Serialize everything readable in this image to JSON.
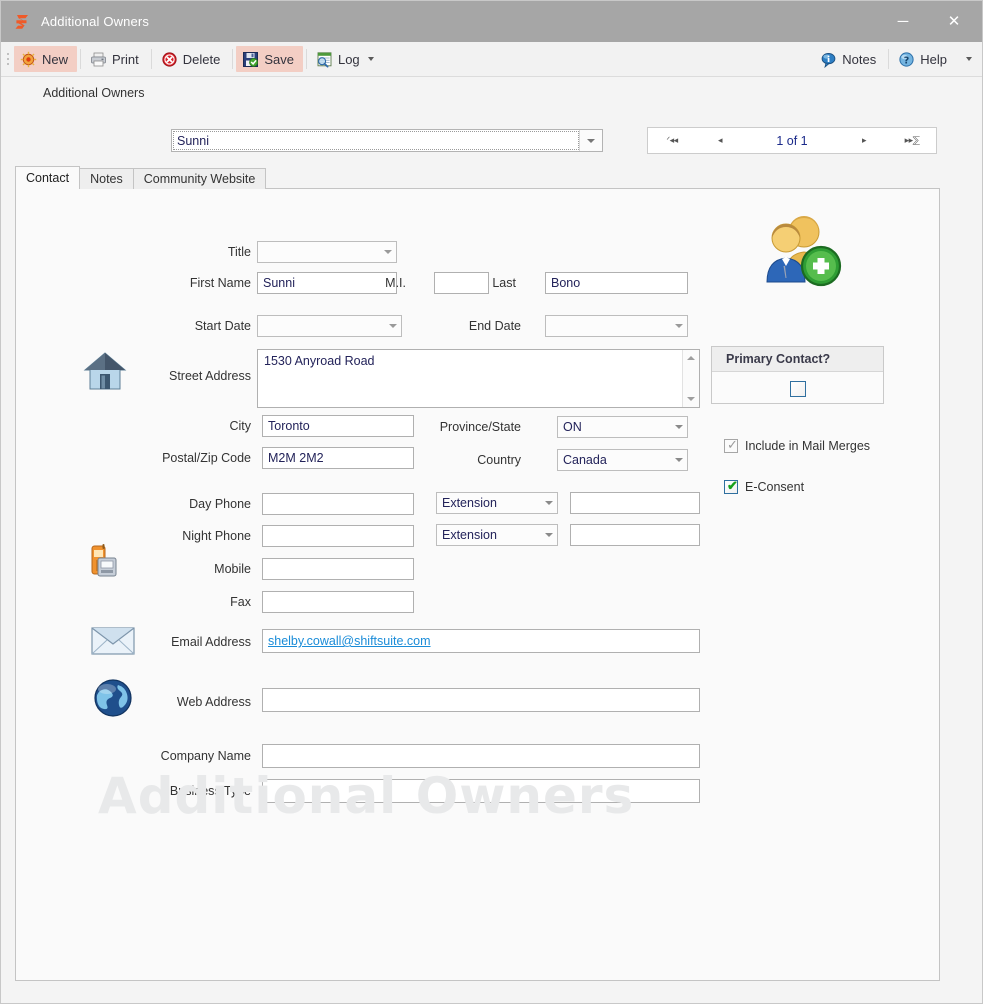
{
  "window": {
    "title": "Additional Owners",
    "app_icon": "shiftsuite-logo-icon",
    "minimize_label": "─",
    "close_label": "✕"
  },
  "toolbar": {
    "buttons": [
      {
        "label": "New",
        "icon": "new-record-icon",
        "highlighted": true
      },
      {
        "label": "Print",
        "icon": "printer-icon",
        "highlighted": false
      },
      {
        "label": "Delete",
        "icon": "delete-stop-icon",
        "highlighted": false
      },
      {
        "label": "Save",
        "icon": "save-disk-icon",
        "highlighted": true
      },
      {
        "label": "Log",
        "icon": "log-search-icon",
        "highlighted": false,
        "has_caret": true
      }
    ],
    "right_buttons": [
      {
        "label": "Notes",
        "icon": "notes-balloon-icon"
      },
      {
        "label": "Help",
        "icon": "help-question-icon"
      }
    ],
    "overflow_icon": "chevron-down-icon"
  },
  "record_selector": {
    "label": "Additional Owners",
    "value": "Sunni",
    "placeholder": ""
  },
  "navigator": {
    "first_label": "ᐟ◂◂",
    "prev_label": "◂",
    "position": "1 of 1",
    "next_label": "▸",
    "last_label": "▸▸⅀"
  },
  "tabs": [
    {
      "label": "Contact",
      "active": true
    },
    {
      "label": "Notes",
      "active": false
    },
    {
      "label": "Community Website",
      "active": false
    }
  ],
  "form": {
    "title": {
      "label": "Title",
      "value": ""
    },
    "first_name": {
      "label": "First Name",
      "value": "Sunni"
    },
    "mi": {
      "label": "M.I.",
      "value": ""
    },
    "last": {
      "label": "Last",
      "value": "Bono"
    },
    "start_date": {
      "label": "Start Date",
      "value": ""
    },
    "end_date": {
      "label": "End Date",
      "value": ""
    },
    "street_address": {
      "label": "Street Address",
      "value": "1530 Anyroad Road",
      "icon": "house-icon"
    },
    "city": {
      "label": "City",
      "value": "Toronto"
    },
    "province_state": {
      "label": "Province/State",
      "value": "ON"
    },
    "postal_zip": {
      "label": "Postal/Zip Code",
      "value": "M2M 2M2"
    },
    "country": {
      "label": "Country",
      "value": "Canada"
    },
    "phone_icon": "phone-fax-icon",
    "day_phone": {
      "label": "Day Phone",
      "value": ""
    },
    "day_ext_select": {
      "label": "Extension",
      "value": ""
    },
    "day_ext_value": {
      "value": ""
    },
    "night_phone": {
      "label": "Night Phone",
      "value": ""
    },
    "night_ext_select": {
      "label": "Extension",
      "value": ""
    },
    "night_ext_value": {
      "value": ""
    },
    "mobile": {
      "label": "Mobile",
      "value": ""
    },
    "fax": {
      "label": "Fax",
      "value": ""
    },
    "email": {
      "label": "Email Address",
      "value": "shelby.cowall@shiftsuite.com",
      "icon": "envelope-icon"
    },
    "web": {
      "label": "Web Address",
      "value": "",
      "icon": "globe-icon"
    },
    "company_name": {
      "label": "Company Name",
      "value": ""
    },
    "business_type": {
      "label": "Business Type",
      "value": ""
    }
  },
  "side_panel": {
    "person_icon": "add-owners-icon",
    "primary_contact": {
      "header": "Primary Contact?",
      "checked": false
    },
    "include_mail_merges": {
      "label": "Include in Mail Merges",
      "checked": true,
      "disabled": true,
      "check_glyph": "✓"
    },
    "e_consent": {
      "label": "E-Consent",
      "checked": true,
      "disabled": false,
      "check_glyph": "✔"
    }
  },
  "watermark": {
    "text": "Additional Owners"
  },
  "colors": {
    "titlebar": "#a6a6a6",
    "toolbar_highlight": "#f3cec4",
    "accent_link": "#1a8cd8",
    "nav_text": "#1b2a8a",
    "field_text": "#23235a",
    "watermark": "#e8e9ea"
  }
}
